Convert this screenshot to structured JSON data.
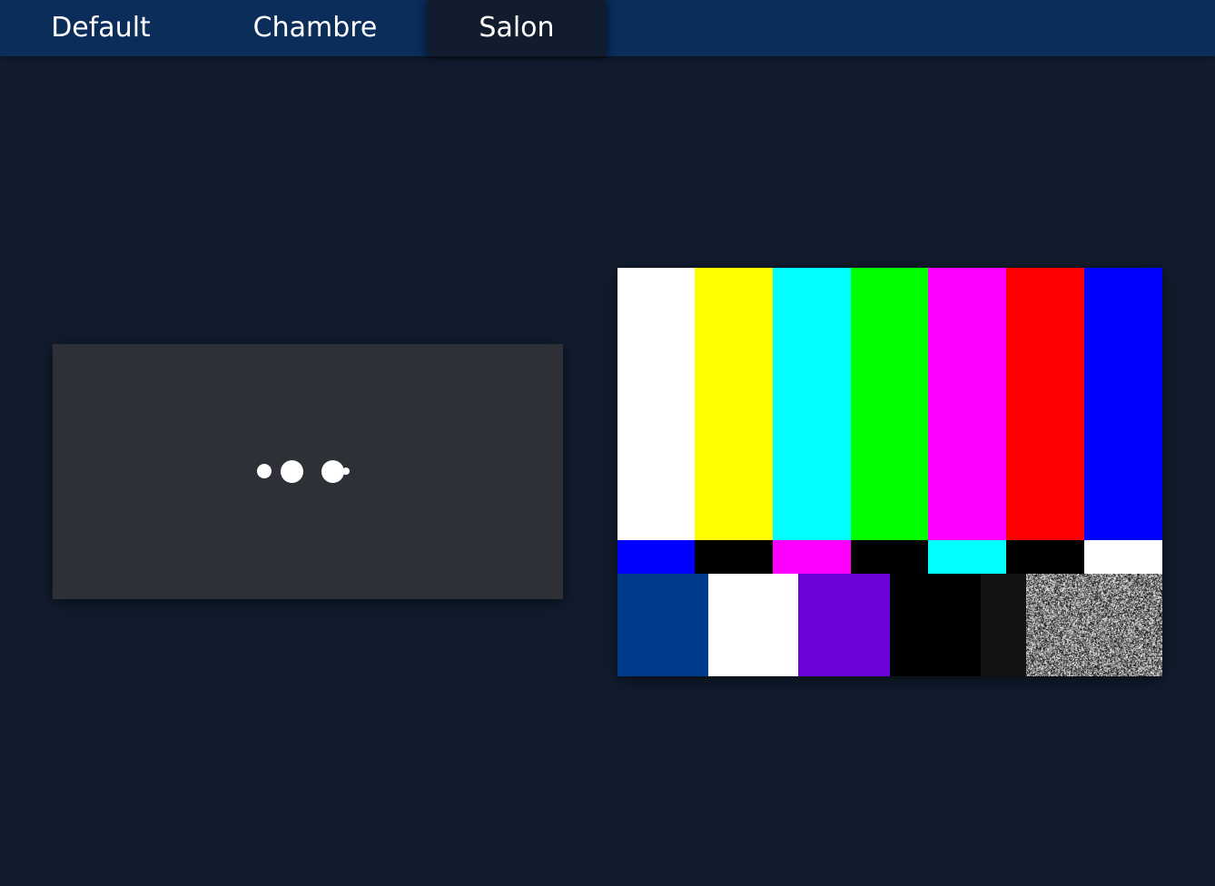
{
  "tabs": [
    {
      "label": "Default",
      "active": false
    },
    {
      "label": "Chambre",
      "active": false
    },
    {
      "label": "Salon",
      "active": true
    }
  ],
  "colors": {
    "tabbar_bg": "#0b2d5a",
    "page_bg": "#111c2e",
    "panel_bg": "#2e3038",
    "text": "#ffffff"
  },
  "loading_panel": {
    "indicator": "loading-dots"
  },
  "test_card": {
    "image": "smpte-color-bars",
    "top_bars": [
      "#ffffff",
      "#ffff00",
      "#00ffff",
      "#00ff00",
      "#ff00ff",
      "#ff0000",
      "#0000ff"
    ],
    "middle_bars": [
      "#0000ff",
      "#000000",
      "#ff00ff",
      "#000000",
      "#00ffff",
      "#000000",
      "#ffffff"
    ],
    "bottom_blocks": [
      "#003a8c",
      "#ffffff",
      "#6e00d8",
      "#000000",
      "#121212",
      "noise"
    ]
  }
}
